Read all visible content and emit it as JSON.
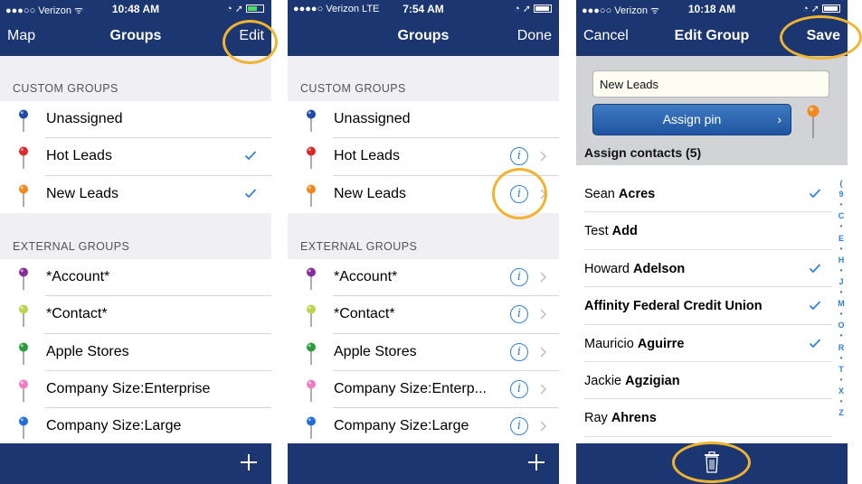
{
  "colors": {
    "nav_bar": "#1b3670",
    "accent_blue": "#2f80d5",
    "highlight_ring": "#f0b430",
    "pins": {
      "unassigned": "#1f4aa8",
      "hot_leads": "#e0252b",
      "new_leads": "#f08a1f",
      "account": "#8a2d9a",
      "contact": "#b9d44d",
      "apple_stores": "#2c9a3e",
      "company_enterprise": "#f07ec2",
      "company_large": "#1f6fd6"
    }
  },
  "screens": [
    {
      "status": {
        "carrier": "●●●○○ Verizon ᯤ",
        "time": "10:48 AM",
        "right": "◔ ➚",
        "battery": "green"
      },
      "nav": {
        "left": "Map",
        "title": "Groups",
        "right": "Edit"
      },
      "custom_header": "CUSTOM GROUPS",
      "custom_groups": [
        {
          "label": "Unassigned",
          "pin": "unassigned",
          "checked": false
        },
        {
          "label": "Hot Leads",
          "pin": "hot_leads",
          "checked": true
        },
        {
          "label": "New Leads",
          "pin": "new_leads",
          "checked": true
        }
      ],
      "external_header": "EXTERNAL GROUPS",
      "external_groups": [
        {
          "label": "*Account*",
          "pin": "account",
          "checked": false
        },
        {
          "label": "*Contact*",
          "pin": "contact",
          "checked": false
        },
        {
          "label": "Apple Stores",
          "pin": "apple_stores",
          "checked": false
        },
        {
          "label": "Company Size:Enterprise",
          "pin": "company_enterprise",
          "checked": false
        },
        {
          "label": "Company Size:Large",
          "pin": "company_large",
          "checked": false
        }
      ]
    },
    {
      "status": {
        "carrier": "●●●●○ Verizon   LTE",
        "time": "7:54 AM",
        "right": "◔ ➚",
        "battery": "white"
      },
      "nav": {
        "left": "",
        "title": "Groups",
        "right": "Done"
      },
      "custom_header": "CUSTOM GROUPS",
      "custom_groups": [
        {
          "label": "Unassigned",
          "pin": "unassigned",
          "info": false
        },
        {
          "label": "Hot Leads",
          "pin": "hot_leads",
          "info": true
        },
        {
          "label": "New Leads",
          "pin": "new_leads",
          "info": true
        }
      ],
      "external_header": "EXTERNAL GROUPS",
      "external_groups": [
        {
          "label": "*Account*",
          "pin": "account",
          "info": true
        },
        {
          "label": "*Contact*",
          "pin": "contact",
          "info": true
        },
        {
          "label": "Apple Stores",
          "pin": "apple_stores",
          "info": true
        },
        {
          "label": "Company Size:Enterp...",
          "pin": "company_enterprise",
          "info": true
        },
        {
          "label": "Company Size:Large",
          "pin": "company_large",
          "info": true
        }
      ],
      "info_glyph": "i"
    },
    {
      "status": {
        "carrier": "●●●○○ Verizon ᯤ",
        "time": "10:18 AM",
        "right": "◔ ➚",
        "battery": "white"
      },
      "nav": {
        "left": "Cancel",
        "title": "Edit Group",
        "right": "Save"
      },
      "group_name_value": "New Leads",
      "assign_pin_label": "Assign pin",
      "assign_pin_chevron": "›",
      "selected_pin": "new_leads",
      "assign_contacts_label": "Assign contacts (5)",
      "contacts": [
        {
          "first": "Sean",
          "last": "Acres",
          "checked": true
        },
        {
          "first": "Test",
          "last": "Add",
          "checked": false
        },
        {
          "first": "Howard",
          "last": "Adelson",
          "checked": true
        },
        {
          "first": "",
          "last": "Affinity Federal Credit Union",
          "checked": true
        },
        {
          "first": "Mauricio",
          "last": "Aguirre",
          "checked": true
        },
        {
          "first": "Jackie",
          "last": "Agzigian",
          "checked": false
        },
        {
          "first": "Ray",
          "last": "Ahrens",
          "checked": false
        }
      ],
      "index_letters": [
        "(",
        "9",
        "•",
        "C",
        "•",
        "E",
        "•",
        "H",
        "•",
        "J",
        "•",
        "M",
        "•",
        "O",
        "•",
        "R",
        "•",
        "T",
        "•",
        "X",
        "•",
        "Z"
      ]
    }
  ]
}
